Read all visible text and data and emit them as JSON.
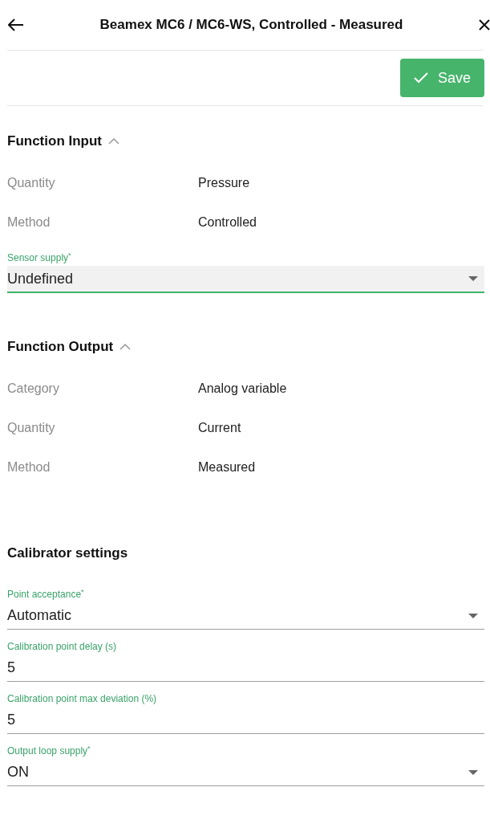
{
  "header": {
    "title": "Beamex MC6 / MC6-WS, Controlled - Measured"
  },
  "toolbar": {
    "save_label": "Save"
  },
  "function_input": {
    "title": "Function Input",
    "expanded": true,
    "rows": [
      {
        "label": "Quantity",
        "value": "Pressure"
      },
      {
        "label": "Method",
        "value": "Controlled"
      }
    ],
    "fields": [
      {
        "kind": "select",
        "label": "Sensor supply$^{*}$",
        "value": "Undefined",
        "focused": true
      }
    ]
  },
  "function_output": {
    "title": "Function Output",
    "expanded": true,
    "rows": [
      {
        "label": "Category",
        "value": "Analog variable"
      },
      {
        "label": "Quantity",
        "value": "Current"
      },
      {
        "label": "Method",
        "value": "Measured"
      }
    ]
  },
  "calibrator_settings": {
    "title": "Calibrator settings",
    "fields": [
      {
        "kind": "select",
        "label": "Point acceptance$^{*}$",
        "value": "Automatic",
        "focused": false
      },
      {
        "kind": "text",
        "label": "Calibration point delay (s)",
        "value": "5",
        "focused": false
      },
      {
        "kind": "text",
        "label": "Calibration point max deviation (%)",
        "value": "5",
        "focused": false
      },
      {
        "kind": "select",
        "label": "Output loop supply$^{*}$",
        "value": "ON",
        "focused": false
      }
    ]
  }
}
